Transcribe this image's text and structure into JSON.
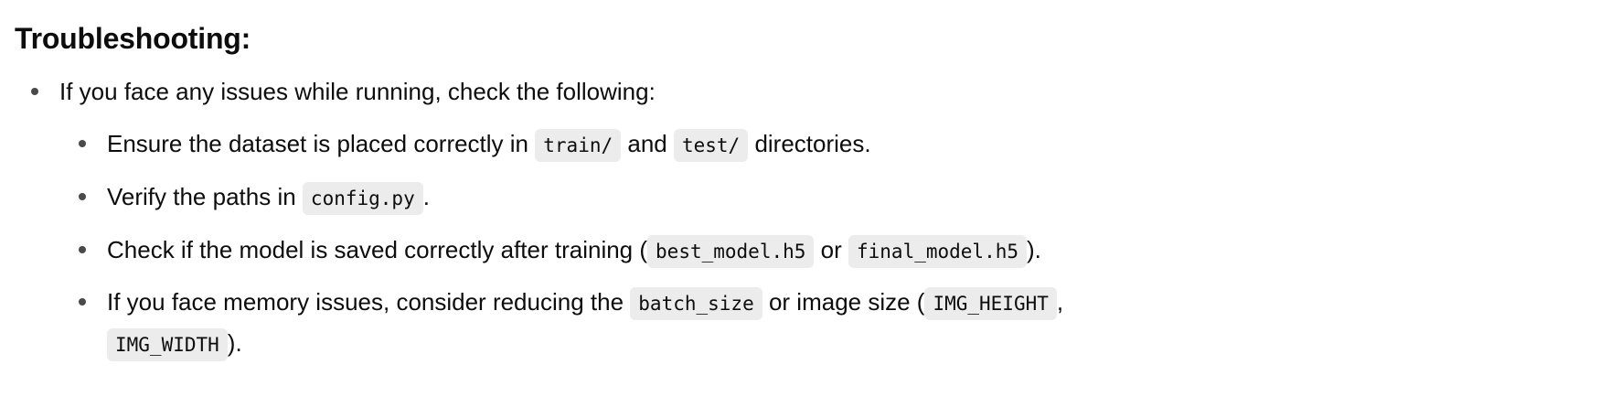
{
  "heading": "Troubleshooting:",
  "intro": "If you face any issues while running, check the following:",
  "items": [
    {
      "t1": "Ensure the dataset is placed correctly in",
      "c1": "train/",
      "t2": "and",
      "c2": "test/",
      "t3": "directories."
    },
    {
      "t1": "Verify the paths in",
      "c1": "config.py",
      "t2": "."
    },
    {
      "t1": "Check if the model is saved correctly after training (",
      "c1": "best_model.h5",
      "t2": "or",
      "c2": "final_model.h5",
      "t3": ")."
    },
    {
      "t1": "If you face memory issues, consider reducing the",
      "c1": "batch_size",
      "t2": "or image size (",
      "c2": "IMG_HEIGHT",
      "t3": ",",
      "c3": "IMG_WIDTH",
      "t4": ")."
    }
  ]
}
